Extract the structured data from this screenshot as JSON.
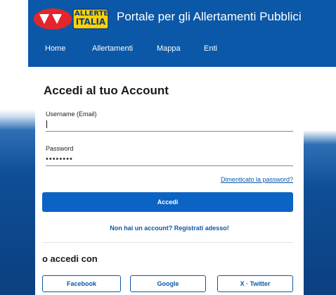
{
  "header": {
    "logo_line1": "ALLERTE",
    "logo_line2": "ITALIA",
    "portal_title": "Portale per gli Allertamenti Pubblici",
    "nav": [
      "Home",
      "Allertamenti",
      "Mappa",
      "Enti"
    ]
  },
  "login": {
    "title": "Accedi al tuo Account",
    "username_label": "Username (Email)",
    "username_value": "",
    "password_label": "Password",
    "password_value": "••••••••",
    "forgot_link": "Dimenticato la password?",
    "submit_label": "Accedi",
    "register_link": "Non hai un account? Registrati adesso!"
  },
  "social": {
    "title": "o accedi con",
    "buttons": [
      "Facebook",
      "Google",
      "X · Twitter"
    ]
  },
  "colors": {
    "brand_blue": "#0b58a8",
    "button_blue": "#0b63c4",
    "logo_red": "#e3262b",
    "logo_yellow": "#ffd200"
  }
}
